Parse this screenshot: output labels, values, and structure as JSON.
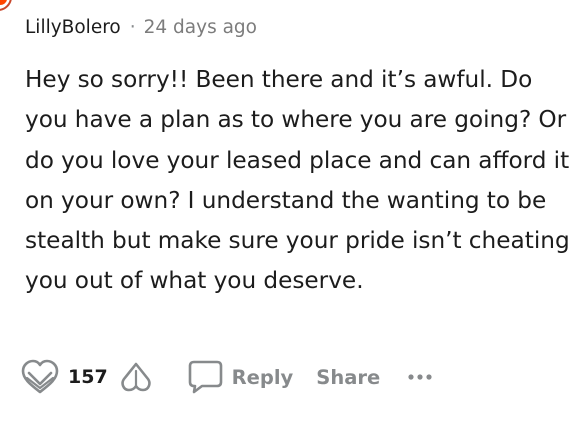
{
  "comment": {
    "author": "LillyBolero",
    "separator": "·",
    "timestamp": "24 days ago",
    "body": "Hey so sorry!! Been there and it’s awful. Do you have a plan as to where you are going? Or do you love your leased place and can afford it on your own? I understand the wanting to be stealth but make sure your pride isn’t cheating you out of what you deserve."
  },
  "actions": {
    "vote_count": "157",
    "reply_label": "Reply",
    "share_label": "Share"
  },
  "icons": {
    "avatar": "avatar",
    "upvote": "upvote-icon",
    "downvote": "downvote-icon",
    "reply": "comment-icon",
    "more": "more-options-icon"
  },
  "colors": {
    "text": "#1c1c1c",
    "muted": "#878a8c",
    "icon": "#878a8c"
  }
}
